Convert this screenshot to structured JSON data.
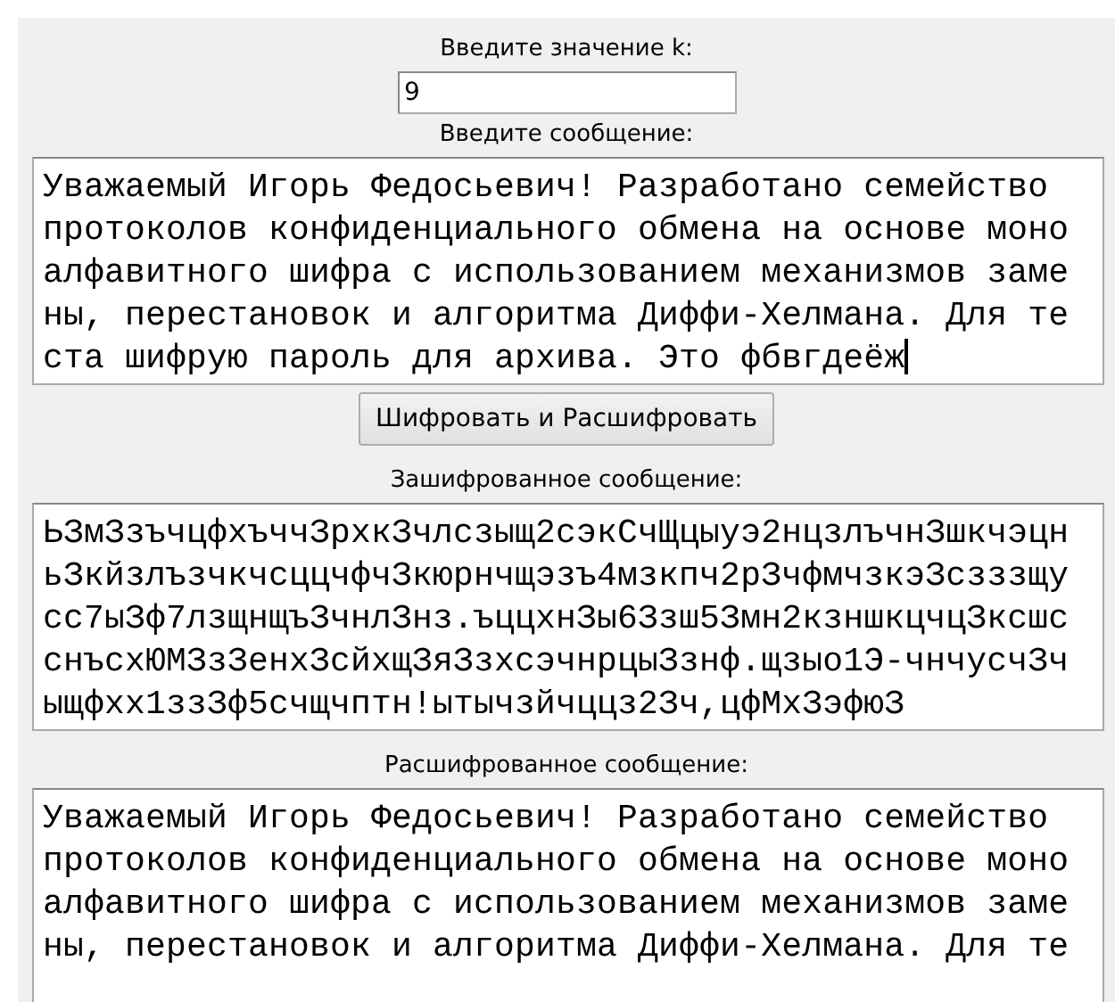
{
  "k_label": "Введите значение k:",
  "k_field": {
    "value": "9"
  },
  "message_label": "Введите сообщение:",
  "message_field": {
    "focused": true,
    "lines": [
      "Уважаемый Игорь Федосьевич! Разработано семейство",
      "протоколов конфиденциального обмена на основе моно",
      "алфавитного шифра с использованием механизмов заме",
      "ны, перестановок и алгоритма Диффи-Хелмана. Для те",
      "ста шифрую пароль для архива. Это фбвгдеёж"
    ]
  },
  "button": "Шифровать и Расшифровать",
  "encrypted_label": "Зашифрованное сообщение:",
  "encrypted_field": {
    "focused": false,
    "lines": [
      "ЬЗмЗзъчцфхъччЗрхкЗчлсзыщ2сэкСчЩцыуэ2нцзлъчнЗшкчэцн",
      "ьЗкйзлъзчкчсццчфчЗкюрнчщэзъ4мзкпч2рЗчфмчзкэЗсзззщу",
      "сс7ыЗф7лзщнщъЗчнлЗнз.ъццхнЗы6Ззш5Змн2кзншкцчцЗксшс",
      "снъсхЮМЗзЗенхЗсйхщЗяЗзхсэчнрцыЗзнф.щзыо1Э-чнчусчЗч",
      "ыщфхх1ззЗф5счщчптн!ытычзйчццз2Зч,цфМхЗэфюЗ"
    ]
  },
  "decrypted_label": "Расшифрованное сообщение:",
  "decrypted_field": {
    "focused": false,
    "lines": [
      "Уважаемый Игорь Федосьевич! Разработано семейство",
      "протоколов конфиденциального обмена на основе моно",
      "алфавитного шифра с использованием механизмов заме",
      "ны, перестановок и алгоритма Диффи-Хелмана. Для те"
    ]
  }
}
